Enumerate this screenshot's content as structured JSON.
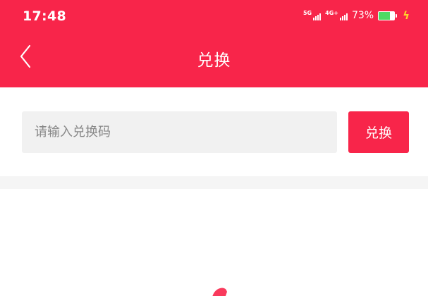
{
  "status_bar": {
    "time": "17:48",
    "net1_label": "5G",
    "net2_label": "4G+",
    "battery_percent": "73%",
    "battery_level": 0.73
  },
  "nav": {
    "title": "兑换",
    "back_icon": "chevron-left-icon"
  },
  "redeem": {
    "input_placeholder": "请输入兑换码",
    "input_value": "",
    "button_label": "兑换"
  },
  "colors": {
    "brand": "#f8254a",
    "input_bg": "#f1f1f1",
    "battery_fill": "#4cd964",
    "charging": "#ffd42a"
  }
}
